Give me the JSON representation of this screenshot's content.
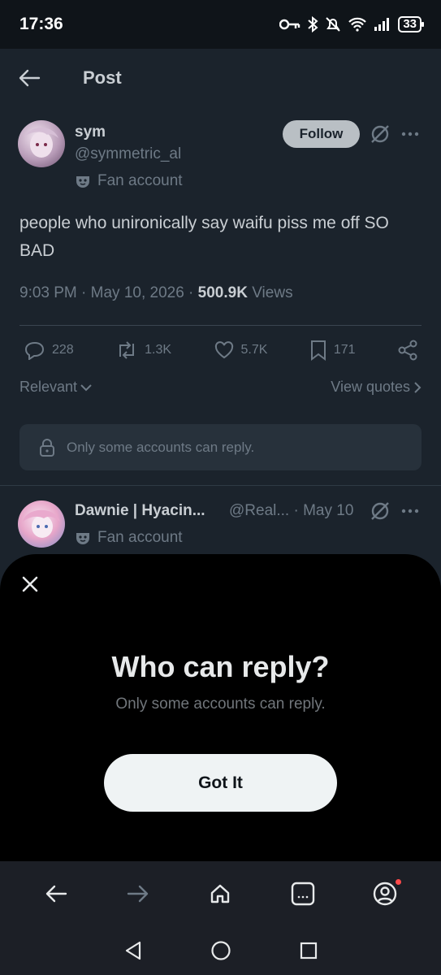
{
  "status_bar": {
    "time": "17:36",
    "battery": "33"
  },
  "header": {
    "title": "Post"
  },
  "post": {
    "author_name": "sym",
    "author_handle": "@symmetric_al",
    "author_badge": "Fan account",
    "follow_label": "Follow",
    "text": "people who unironically say waifu piss me off SO BAD",
    "time": "9:03 PM · May 10, 2026 · ",
    "views_count": "500.9K",
    "views_label": " Views",
    "stats": {
      "replies": "228",
      "reposts": "1.3K",
      "likes": "5.7K",
      "bookmarks": "171"
    }
  },
  "sort": {
    "relevant": "Relevant",
    "view_quotes": "View quotes"
  },
  "reply_restriction": "Only some accounts can reply.",
  "reply": {
    "name": "Dawnie | Hyacin...",
    "handle_date": "@Real... · May 10",
    "badge": "Fan account"
  },
  "sheet": {
    "title": "Who can reply?",
    "subtitle": "Only some accounts can reply.",
    "button": "Got It"
  },
  "colors": {
    "sheet_bg": "#000000",
    "page_bg": "#1b232c",
    "button_bg": "#eff3f4",
    "notification_dot": "#ff4a4a"
  },
  "icons": [
    "back-arrow-icon",
    "grok-icon",
    "more-icon",
    "reply-icon",
    "repost-icon",
    "like-icon",
    "bookmark-icon",
    "share-icon",
    "lock-icon",
    "close-icon",
    "home-icon",
    "tabs-icon",
    "profile-icon"
  ]
}
